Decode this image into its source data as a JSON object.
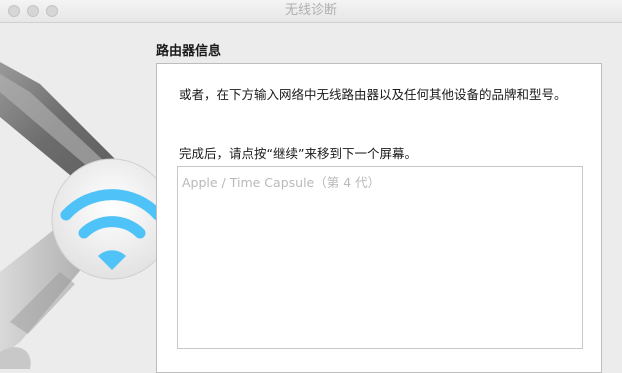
{
  "window": {
    "title": "无线诊断"
  },
  "section": {
    "title": "路由器信息"
  },
  "panel": {
    "instruction": "或者，在下方输入网络中无线路由器以及任何其他设备的品牌和型号。",
    "instruction2": "完成后，请点按“继续”来移到下一个屏幕。",
    "input": {
      "value": "",
      "placeholder": "Apple / Time Capsule（第 4 代）"
    }
  },
  "icons": {
    "art": "wrench-wifi-icon"
  },
  "colors": {
    "wifi_blue": "#4fc3f7",
    "background": "#ececec"
  }
}
